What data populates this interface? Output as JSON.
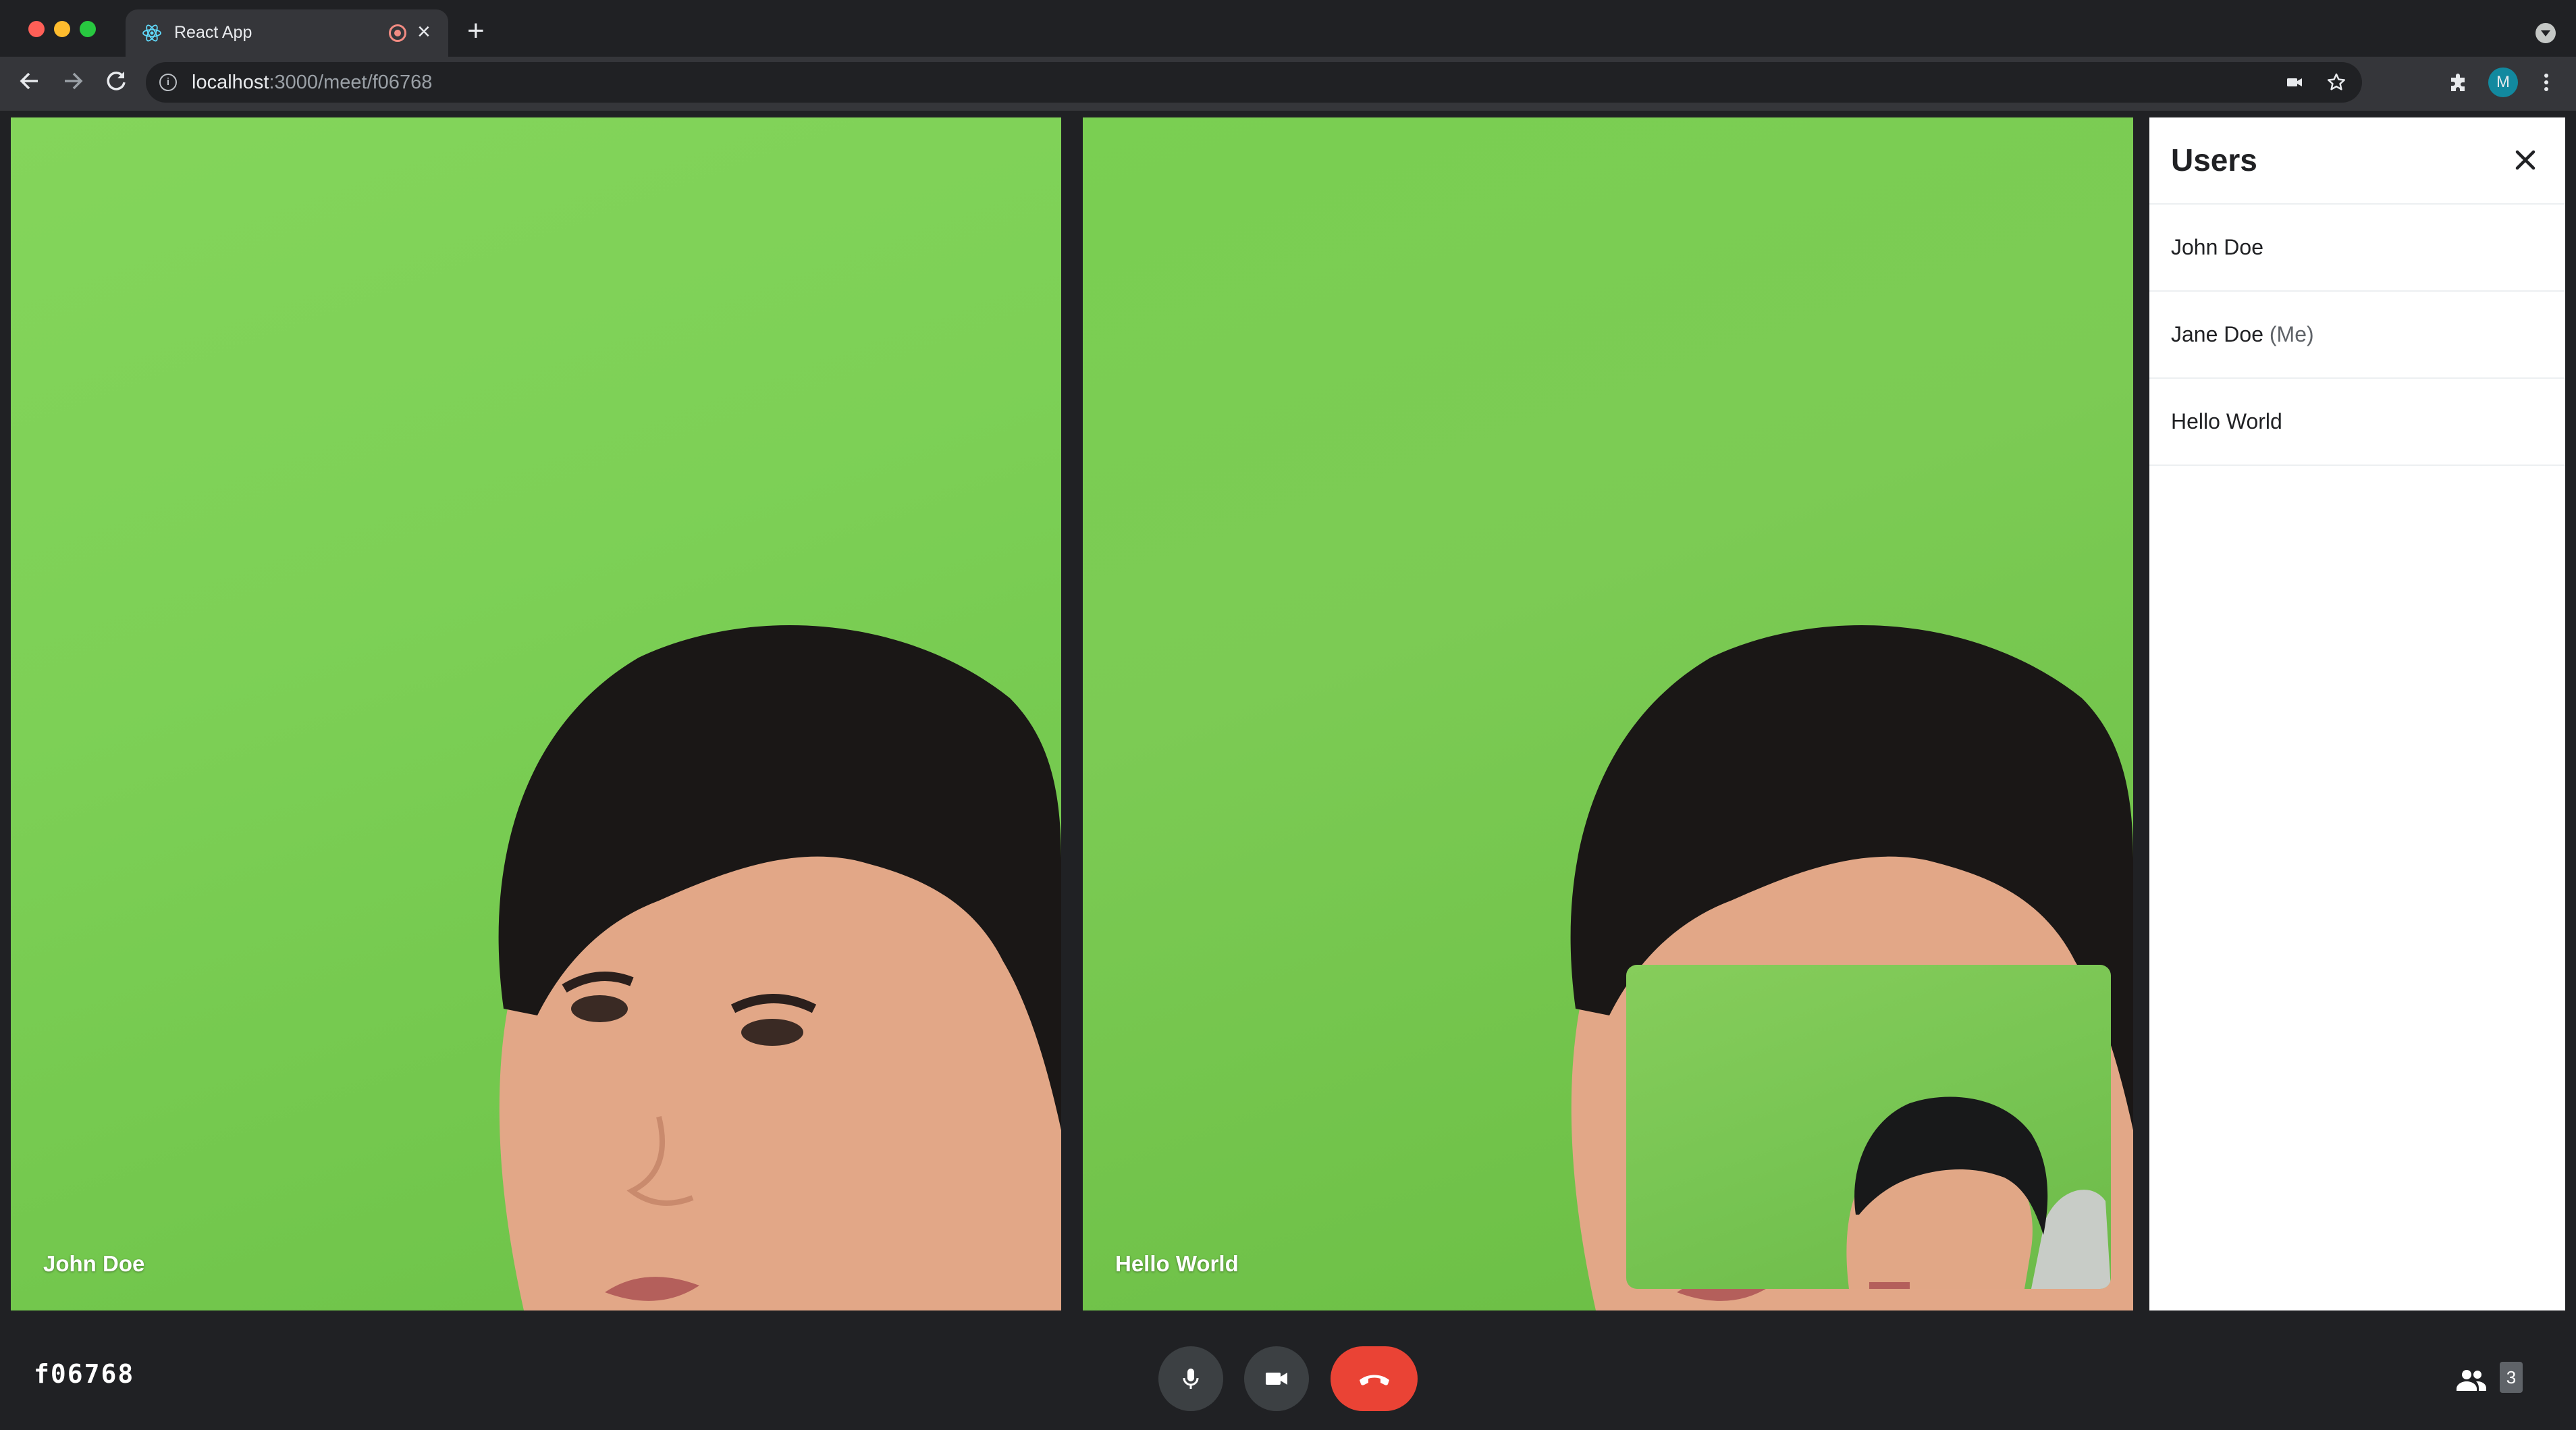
{
  "browser": {
    "tab_title": "React App",
    "tab_close": "×",
    "new_tab": "+",
    "url_host": "localhost",
    "url_rest": ":3000/meet/f06768",
    "profile_initial": "M"
  },
  "tiles": [
    {
      "name": "John Doe"
    },
    {
      "name": "Hello World"
    }
  ],
  "users_panel": {
    "title": "Users",
    "users": [
      {
        "name": "John Doe",
        "suffix": ""
      },
      {
        "name": "Jane Doe",
        "suffix": "(Me)"
      },
      {
        "name": "Hello World",
        "suffix": ""
      }
    ]
  },
  "footer": {
    "meeting_code": "f06768",
    "participant_count": "3"
  },
  "colors": {
    "end_call": "#ea4335",
    "control_bg": "#3c4043",
    "green_screen": "#7dd056",
    "profile": "#12899f"
  },
  "icons": [
    "react-icon",
    "record-icon",
    "close-icon",
    "plus-icon",
    "back-arrow-icon",
    "forward-arrow-icon",
    "reload-icon",
    "info-icon",
    "camera-icon",
    "star-icon",
    "puzzle-icon",
    "kebab-menu-icon",
    "microphone-icon",
    "video-camera-icon",
    "phone-hangup-icon",
    "people-icon"
  ]
}
